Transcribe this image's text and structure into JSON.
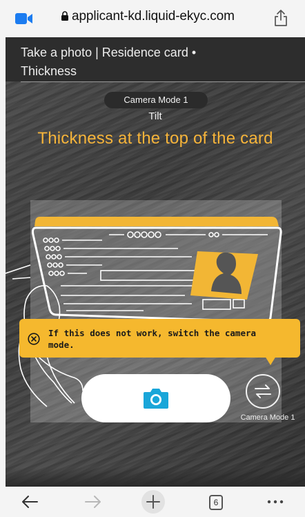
{
  "browser": {
    "url": "applicant-kd.liquid-ekyc.com",
    "open_tabs": "6"
  },
  "header": {
    "title": "Take a photo | Residence card • Thickness"
  },
  "camera": {
    "mode_pill": "Camera Mode 1",
    "tilt_label": "Tilt",
    "instruction": "Thickness at the top of the card",
    "switch_label": "Camera Mode 1"
  },
  "warning": {
    "message": "If this does not work, switch the camera mode."
  },
  "colors": {
    "accent_orange": "#f6b43a",
    "warning_bg": "#f5b82e",
    "camera_icon": "#1aa6d9",
    "card_overlay": "#f2b635"
  },
  "icons": {
    "video": "facetime-video-icon",
    "lock": "lock-icon",
    "share": "share-icon",
    "warning": "close-circle-icon",
    "shutter": "camera-icon",
    "switch": "switch-arrows-icon",
    "back": "arrow-left-icon",
    "forward": "arrow-right-icon",
    "new_tab": "plus-icon",
    "tabs": "tabs-icon",
    "more": "more-dots-icon"
  }
}
